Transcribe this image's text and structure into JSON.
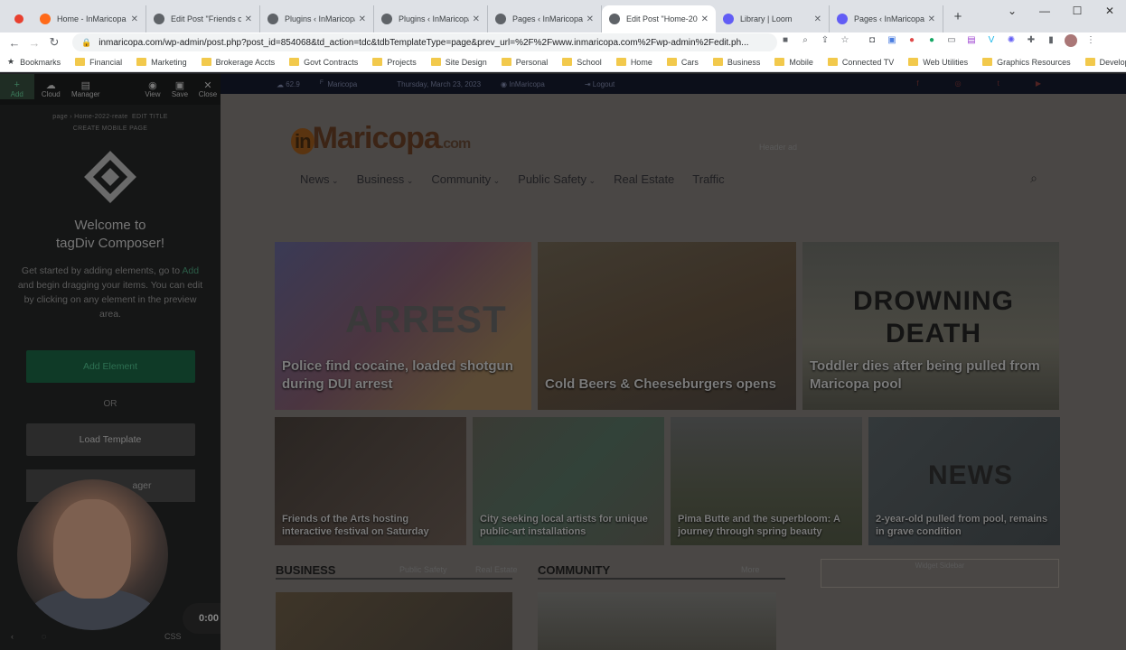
{
  "browser": {
    "tabs": [
      {
        "title": "Home - InMaricopa",
        "fav": "inmaricopa-icon",
        "color": "#ff6a1a"
      },
      {
        "title": "Edit Post \"Friends of",
        "fav": "globe-icon",
        "color": "#5f6368"
      },
      {
        "title": "Plugins ‹ InMaricopa",
        "fav": "globe-icon",
        "color": "#5f6368"
      },
      {
        "title": "Plugins ‹ InMaricopa",
        "fav": "globe-icon",
        "color": "#5f6368"
      },
      {
        "title": "Pages ‹ InMaricopa",
        "fav": "globe-icon",
        "color": "#5f6368"
      },
      {
        "title": "Edit Post \"Home-20",
        "fav": "globe-icon",
        "color": "#5f6368"
      },
      {
        "title": "Library | Loom",
        "fav": "loom-icon",
        "color": "#625df5"
      },
      {
        "title": "Pages ‹ InMaricopa",
        "fav": "loom-icon",
        "color": "#625df5"
      }
    ],
    "active_tab": 5,
    "url": "inmaricopa.com/wp-admin/post.php?post_id=854068&td_action=tdc&tdbTemplateType=page&prev_url=%2F%2Fwww.inmaricopa.com%2Fwp-admin%2Fedit.ph...",
    "bookmarks": [
      "Bookmarks",
      "Financial",
      "Marketing",
      "Brokerage Accts",
      "Govt Contracts",
      "Projects",
      "Site Design",
      "Personal",
      "School",
      "Home",
      "Cars",
      "Business",
      "Mobile",
      "Connected TV",
      "Web Utilities",
      "Graphics Resources",
      "Developers"
    ]
  },
  "composer": {
    "toolbar": {
      "add": "Add",
      "cloud": "Cloud",
      "manager": "Manager",
      "view": "View",
      "save": "Save",
      "close": "Close"
    },
    "crumb_page": "page",
    "crumb_name": "Home-2022-reate",
    "crumb_edit": "EDIT TITLE",
    "crumb_mobile": "CREATE MOBILE PAGE",
    "welcome_line1": "Welcome to",
    "welcome_line2": "tagDiv Composer!",
    "desc_a": "Get started by adding elements, go to",
    "desc_link": "Add",
    "desc_b": "and begin dragging your items. You can edit by clicking on any element in the preview area.",
    "add_element": "Add Element",
    "or": "OR",
    "load_template": "Load Template",
    "manager_btn": "ager",
    "bottom_css": "CSS"
  },
  "recorder": {
    "time": "0:00"
  },
  "site": {
    "weather": "62.9",
    "weather_unit": "F",
    "city": "Maricopa",
    "date": "Thursday, March 23, 2023",
    "user": "InMaricopa",
    "logout": "Logout",
    "logo_main": "Maricopa",
    "logo_in": "in",
    "logo_tld": ".com",
    "header_ad": "Header ad",
    "menu": [
      "News",
      "Business",
      "Community",
      "Public Safety",
      "Real Estate",
      "Traffic"
    ],
    "big_tiles": [
      {
        "overlay": "ARREST",
        "caption": "Police find cocaine, loaded shotgun during DUI arrest"
      },
      {
        "overlay": "",
        "caption": "Cold Beers & Cheeseburgers opens"
      },
      {
        "overlay": "DROWNING DEATH",
        "caption": "Toddler dies after being pulled from Maricopa pool"
      }
    ],
    "small_tiles": [
      {
        "overlay": "",
        "caption": "Friends of the Arts hosting interactive festival on Saturday"
      },
      {
        "overlay": "",
        "caption": "City seeking local artists for unique public-art installations"
      },
      {
        "overlay": "",
        "caption": "Pima Butte and the superbloom: A journey through spring beauty"
      },
      {
        "overlay": "NEWS",
        "caption": "2-year-old pulled from pool, remains in grave condition"
      }
    ],
    "sections": {
      "business": "BUSINESS",
      "business_links": [
        "Public Safety",
        "Real Estate"
      ],
      "community": "COMMUNITY",
      "community_link": "More",
      "widget": "Widget Sidebar"
    }
  }
}
